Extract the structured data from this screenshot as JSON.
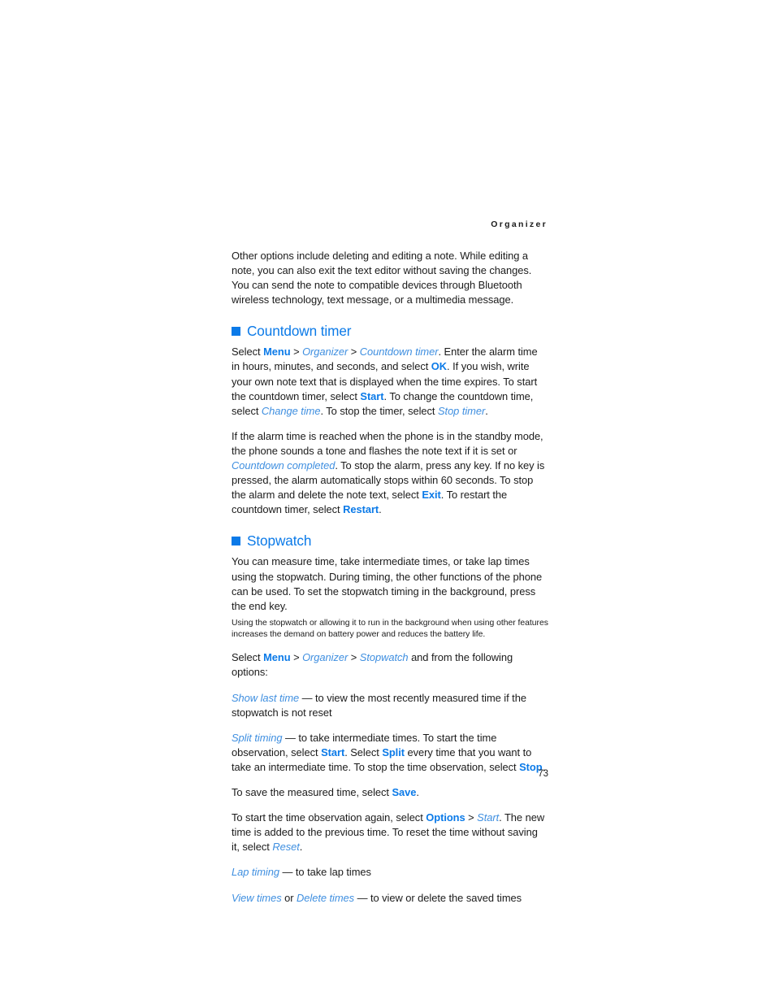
{
  "page": {
    "running_head": "Organizer",
    "page_number": "73"
  },
  "intro": {
    "paragraph": "Other options include deleting and editing a note. While editing a note, you can also exit the text editor without saving the changes. You can send the note to compatible devices through Bluetooth wireless technology, text message, or a multimedia message."
  },
  "countdown": {
    "heading": "Countdown timer",
    "p1": {
      "t1": "Select ",
      "menu": "Menu",
      "gt1": " > ",
      "organizer": "Organizer",
      "gt2": " > ",
      "countdown_timer": "Countdown timer",
      "t2": ". Enter the alarm time in hours, minutes, and seconds, and select ",
      "ok": "OK",
      "t3": ". If you wish, write your own note text that is displayed when the time expires. To start the countdown timer, select ",
      "start": "Start",
      "t4": ". To change the countdown time, select ",
      "change_time": "Change time",
      "t5": ". To stop the timer, select ",
      "stop_timer": "Stop timer",
      "t6": "."
    },
    "p2": {
      "t1": "If the alarm time is reached when the phone is in the standby mode, the phone sounds a tone and flashes the note text if it is set or ",
      "countdown_completed": "Countdown completed",
      "t2": ". To stop the alarm, press any key. If no key is pressed, the alarm automatically stops within 60 seconds. To stop the alarm and delete the note text, select ",
      "exit": "Exit",
      "t3": ". To restart the countdown timer, select ",
      "restart": "Restart",
      "t4": "."
    }
  },
  "stopwatch": {
    "heading": "Stopwatch",
    "p1": "You can measure time, take intermediate times, or take lap times using the stopwatch. During timing, the other functions of the phone can be used. To set the stopwatch timing in the background, press the end key.",
    "note": "Using the stopwatch or allowing it to run in the background when using other features increases the demand on battery power and reduces the battery life.",
    "select_line": {
      "t1": "Select ",
      "menu": "Menu",
      "gt1": " > ",
      "organizer": "Organizer",
      "gt2": " > ",
      "stopwatch": "Stopwatch",
      "t2": " and from the following options:"
    },
    "show_last_time": {
      "term": "Show last time",
      "desc": " — to view the most recently measured time if the stopwatch is not reset"
    },
    "split_timing": {
      "term": "Split timing",
      "t1": " — to take intermediate times. To start the time observation, select ",
      "start": "Start",
      "t2": ". Select ",
      "split": "Split",
      "t3": " every time that you want to take an intermediate time. To stop the time observation, select ",
      "stop": "Stop",
      "t4": "."
    },
    "save_line": {
      "t1": "To save the measured time, select ",
      "save": "Save",
      "t2": "."
    },
    "restart_line": {
      "t1": "To start the time observation again, select ",
      "options": "Options",
      "gt1": " > ",
      "start": "Start",
      "t2": ". The new time is added to the previous time. To reset the time without saving it, select ",
      "reset": "Reset",
      "t3": "."
    },
    "lap_timing": {
      "term": "Lap timing",
      "desc": " — to take lap times"
    },
    "view_delete": {
      "view": "View times",
      "or": " or ",
      "delete": "Delete times",
      "desc": " — to view or delete the saved times"
    }
  },
  "colors": {
    "accent_blue": "#0b7ae8",
    "menu_italic_blue": "#3f8fe0",
    "body_text": "#1b1b1b",
    "page_background": "#ffffff"
  }
}
